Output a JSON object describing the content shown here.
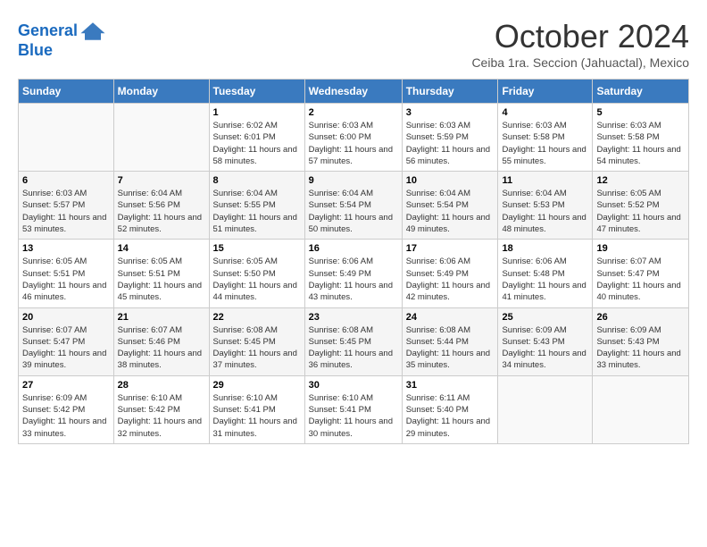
{
  "logo": {
    "line1": "General",
    "line2": "Blue"
  },
  "title": "October 2024",
  "location": "Ceiba 1ra. Seccion (Jahuactal), Mexico",
  "headers": [
    "Sunday",
    "Monday",
    "Tuesday",
    "Wednesday",
    "Thursday",
    "Friday",
    "Saturday"
  ],
  "weeks": [
    [
      {
        "day": "",
        "sunrise": "",
        "sunset": "",
        "daylight": ""
      },
      {
        "day": "",
        "sunrise": "",
        "sunset": "",
        "daylight": ""
      },
      {
        "day": "1",
        "sunrise": "Sunrise: 6:02 AM",
        "sunset": "Sunset: 6:01 PM",
        "daylight": "Daylight: 11 hours and 58 minutes."
      },
      {
        "day": "2",
        "sunrise": "Sunrise: 6:03 AM",
        "sunset": "Sunset: 6:00 PM",
        "daylight": "Daylight: 11 hours and 57 minutes."
      },
      {
        "day": "3",
        "sunrise": "Sunrise: 6:03 AM",
        "sunset": "Sunset: 5:59 PM",
        "daylight": "Daylight: 11 hours and 56 minutes."
      },
      {
        "day": "4",
        "sunrise": "Sunrise: 6:03 AM",
        "sunset": "Sunset: 5:58 PM",
        "daylight": "Daylight: 11 hours and 55 minutes."
      },
      {
        "day": "5",
        "sunrise": "Sunrise: 6:03 AM",
        "sunset": "Sunset: 5:58 PM",
        "daylight": "Daylight: 11 hours and 54 minutes."
      }
    ],
    [
      {
        "day": "6",
        "sunrise": "Sunrise: 6:03 AM",
        "sunset": "Sunset: 5:57 PM",
        "daylight": "Daylight: 11 hours and 53 minutes."
      },
      {
        "day": "7",
        "sunrise": "Sunrise: 6:04 AM",
        "sunset": "Sunset: 5:56 PM",
        "daylight": "Daylight: 11 hours and 52 minutes."
      },
      {
        "day": "8",
        "sunrise": "Sunrise: 6:04 AM",
        "sunset": "Sunset: 5:55 PM",
        "daylight": "Daylight: 11 hours and 51 minutes."
      },
      {
        "day": "9",
        "sunrise": "Sunrise: 6:04 AM",
        "sunset": "Sunset: 5:54 PM",
        "daylight": "Daylight: 11 hours and 50 minutes."
      },
      {
        "day": "10",
        "sunrise": "Sunrise: 6:04 AM",
        "sunset": "Sunset: 5:54 PM",
        "daylight": "Daylight: 11 hours and 49 minutes."
      },
      {
        "day": "11",
        "sunrise": "Sunrise: 6:04 AM",
        "sunset": "Sunset: 5:53 PM",
        "daylight": "Daylight: 11 hours and 48 minutes."
      },
      {
        "day": "12",
        "sunrise": "Sunrise: 6:05 AM",
        "sunset": "Sunset: 5:52 PM",
        "daylight": "Daylight: 11 hours and 47 minutes."
      }
    ],
    [
      {
        "day": "13",
        "sunrise": "Sunrise: 6:05 AM",
        "sunset": "Sunset: 5:51 PM",
        "daylight": "Daylight: 11 hours and 46 minutes."
      },
      {
        "day": "14",
        "sunrise": "Sunrise: 6:05 AM",
        "sunset": "Sunset: 5:51 PM",
        "daylight": "Daylight: 11 hours and 45 minutes."
      },
      {
        "day": "15",
        "sunrise": "Sunrise: 6:05 AM",
        "sunset": "Sunset: 5:50 PM",
        "daylight": "Daylight: 11 hours and 44 minutes."
      },
      {
        "day": "16",
        "sunrise": "Sunrise: 6:06 AM",
        "sunset": "Sunset: 5:49 PM",
        "daylight": "Daylight: 11 hours and 43 minutes."
      },
      {
        "day": "17",
        "sunrise": "Sunrise: 6:06 AM",
        "sunset": "Sunset: 5:49 PM",
        "daylight": "Daylight: 11 hours and 42 minutes."
      },
      {
        "day": "18",
        "sunrise": "Sunrise: 6:06 AM",
        "sunset": "Sunset: 5:48 PM",
        "daylight": "Daylight: 11 hours and 41 minutes."
      },
      {
        "day": "19",
        "sunrise": "Sunrise: 6:07 AM",
        "sunset": "Sunset: 5:47 PM",
        "daylight": "Daylight: 11 hours and 40 minutes."
      }
    ],
    [
      {
        "day": "20",
        "sunrise": "Sunrise: 6:07 AM",
        "sunset": "Sunset: 5:47 PM",
        "daylight": "Daylight: 11 hours and 39 minutes."
      },
      {
        "day": "21",
        "sunrise": "Sunrise: 6:07 AM",
        "sunset": "Sunset: 5:46 PM",
        "daylight": "Daylight: 11 hours and 38 minutes."
      },
      {
        "day": "22",
        "sunrise": "Sunrise: 6:08 AM",
        "sunset": "Sunset: 5:45 PM",
        "daylight": "Daylight: 11 hours and 37 minutes."
      },
      {
        "day": "23",
        "sunrise": "Sunrise: 6:08 AM",
        "sunset": "Sunset: 5:45 PM",
        "daylight": "Daylight: 11 hours and 36 minutes."
      },
      {
        "day": "24",
        "sunrise": "Sunrise: 6:08 AM",
        "sunset": "Sunset: 5:44 PM",
        "daylight": "Daylight: 11 hours and 35 minutes."
      },
      {
        "day": "25",
        "sunrise": "Sunrise: 6:09 AM",
        "sunset": "Sunset: 5:43 PM",
        "daylight": "Daylight: 11 hours and 34 minutes."
      },
      {
        "day": "26",
        "sunrise": "Sunrise: 6:09 AM",
        "sunset": "Sunset: 5:43 PM",
        "daylight": "Daylight: 11 hours and 33 minutes."
      }
    ],
    [
      {
        "day": "27",
        "sunrise": "Sunrise: 6:09 AM",
        "sunset": "Sunset: 5:42 PM",
        "daylight": "Daylight: 11 hours and 33 minutes."
      },
      {
        "day": "28",
        "sunrise": "Sunrise: 6:10 AM",
        "sunset": "Sunset: 5:42 PM",
        "daylight": "Daylight: 11 hours and 32 minutes."
      },
      {
        "day": "29",
        "sunrise": "Sunrise: 6:10 AM",
        "sunset": "Sunset: 5:41 PM",
        "daylight": "Daylight: 11 hours and 31 minutes."
      },
      {
        "day": "30",
        "sunrise": "Sunrise: 6:10 AM",
        "sunset": "Sunset: 5:41 PM",
        "daylight": "Daylight: 11 hours and 30 minutes."
      },
      {
        "day": "31",
        "sunrise": "Sunrise: 6:11 AM",
        "sunset": "Sunset: 5:40 PM",
        "daylight": "Daylight: 11 hours and 29 minutes."
      },
      {
        "day": "",
        "sunrise": "",
        "sunset": "",
        "daylight": ""
      },
      {
        "day": "",
        "sunrise": "",
        "sunset": "",
        "daylight": ""
      }
    ]
  ]
}
